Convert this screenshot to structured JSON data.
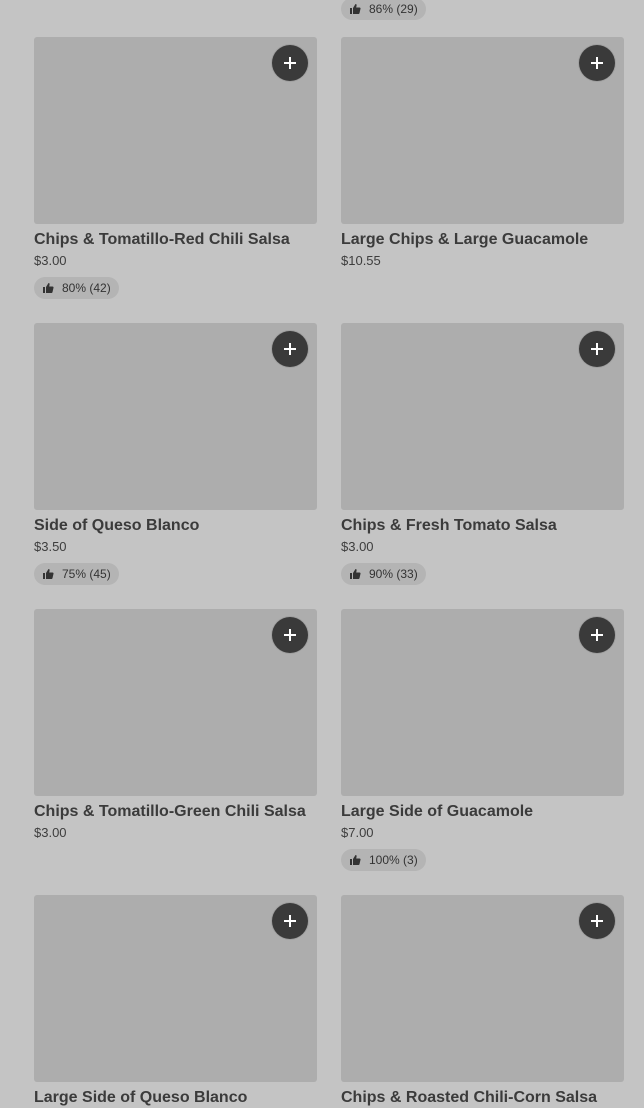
{
  "top_partial_rating": "86% (29)",
  "items": [
    {
      "name": "Chips & Tomatillo-Red Chili Salsa",
      "price": "$3.00",
      "rating": "80% (42)"
    },
    {
      "name": "Large Chips & Large Guacamole",
      "price": "$10.55",
      "rating": null
    },
    {
      "name": "Side of Queso Blanco",
      "price": "$3.50",
      "rating": "75% (45)"
    },
    {
      "name": "Chips & Fresh Tomato Salsa",
      "price": "$3.00",
      "rating": "90% (33)"
    },
    {
      "name": "Chips & Tomatillo-Green Chili Salsa",
      "price": "$3.00",
      "rating": null
    },
    {
      "name": "Large Side of Guacamole",
      "price": "$7.00",
      "rating": "100% (3)"
    },
    {
      "name": "Large Side of Queso Blanco",
      "price": "",
      "rating": null
    },
    {
      "name": "Chips & Roasted Chili-Corn Salsa",
      "price": "",
      "rating": null
    }
  ],
  "icons": {
    "add": "plus-icon",
    "thumb": "thumbs-up-icon"
  },
  "colors": {
    "background": "#c4c4c4",
    "image_placeholder": "#adadad",
    "add_button": "#3a3a3a",
    "rating_chip": "#b4b4b4"
  }
}
